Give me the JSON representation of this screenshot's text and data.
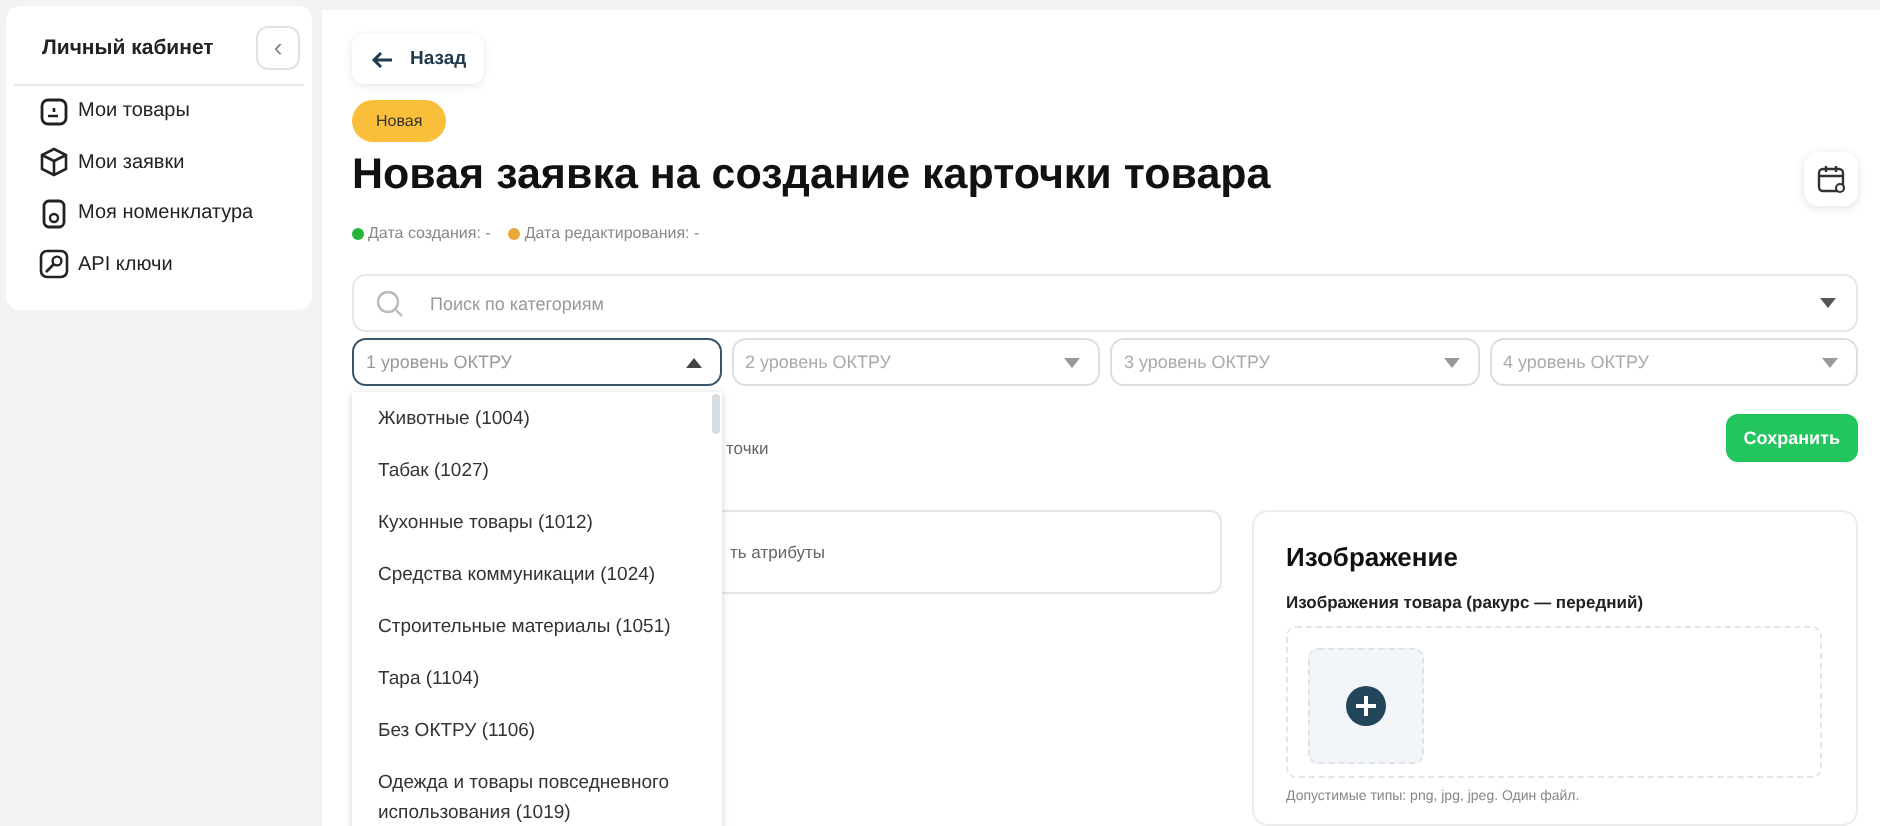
{
  "sidebar": {
    "title": "Личный кабинет",
    "collapse_icon": "‹",
    "items": [
      {
        "label": "Мои товары",
        "kind": "document"
      },
      {
        "label": "Мои заявки",
        "kind": "box"
      },
      {
        "label": "Моя номенклатура",
        "kind": "file"
      },
      {
        "label": "API ключи",
        "kind": "key"
      }
    ]
  },
  "back_button": {
    "label": "Назад"
  },
  "status_badge": "Новая",
  "title": "Новая заявка на создание карточки товара",
  "dates": [
    {
      "label": "Дата создания: -",
      "color": "#22b53a"
    },
    {
      "label": "Дата редактирования: -",
      "color": "#e8a93a"
    }
  ],
  "search": {
    "placeholder": "Поиск по категориям"
  },
  "levels": [
    {
      "placeholder": "1 уровень ОКТРУ",
      "expanded": true
    },
    {
      "placeholder": "2 уровень ОКТРУ",
      "expanded": false
    },
    {
      "placeholder": "3 уровень ОКТРУ",
      "expanded": false
    },
    {
      "placeholder": "4 уровень ОКТРУ",
      "expanded": false
    }
  ],
  "dropdown_options": [
    "Животные (1004)",
    "Табак (1027)",
    "Кухонные товары (1012)",
    "Средства коммуникации (1024)",
    "Строительные материалы (1051)",
    "Тара (1104)",
    "Без ОКТРУ (1106)",
    "Одежда и товары повседневного использования (1019)"
  ],
  "partial_label": "точки",
  "save_button": "Сохранить",
  "attributes_card": {
    "text": "ть атрибуты"
  },
  "image_card": {
    "title": "Изображение",
    "subtitle": "Изображения товара (ракурс — передний)",
    "hint": "Допустимые типы: png, jpg, jpeg. Один файл."
  }
}
